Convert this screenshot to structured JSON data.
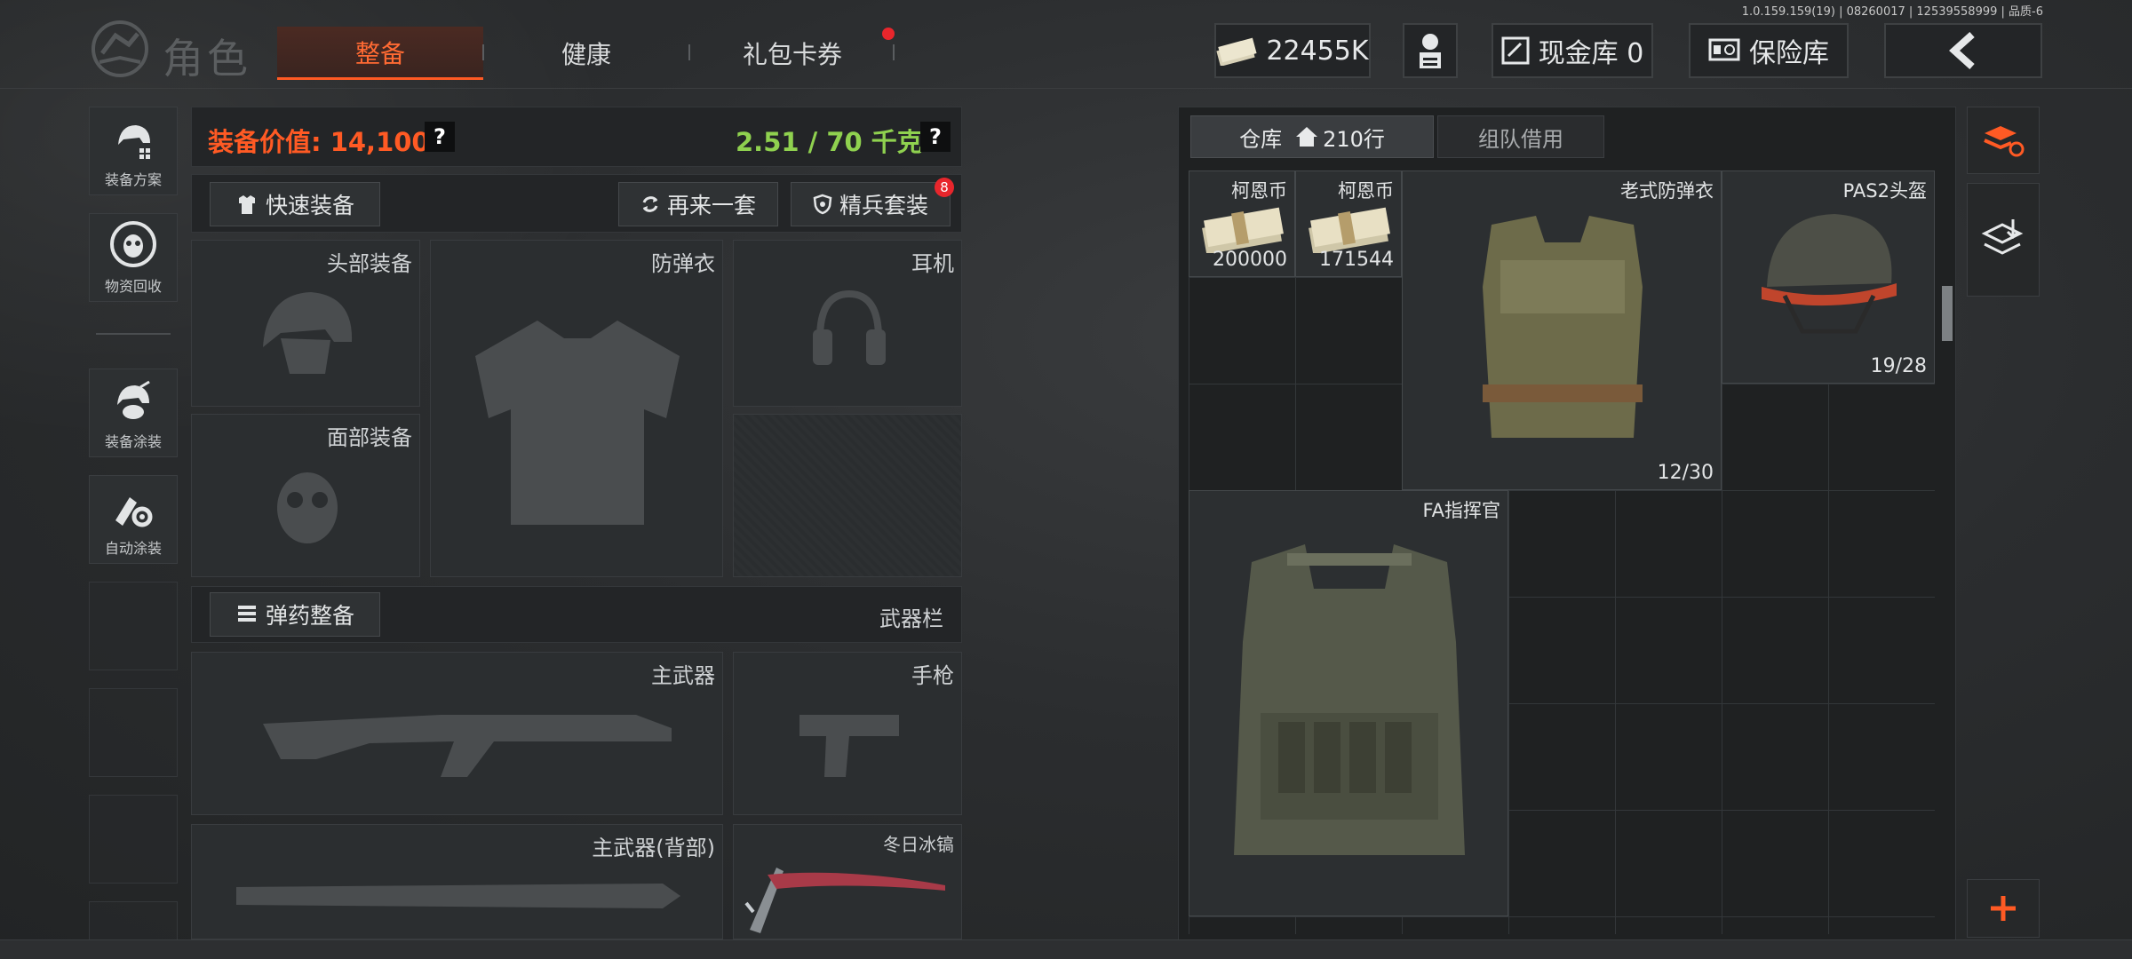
{
  "version_info": "1.0.159.159(19) | 08260017 | 12539558999 | 品质-6",
  "header": {
    "title": "角色",
    "tabs": [
      {
        "label": "整备",
        "active": true
      },
      {
        "label": "健康",
        "active": false
      },
      {
        "label": "礼包卡券",
        "active": false,
        "has_notification": true
      }
    ],
    "currency": "22455K",
    "cash_vault": "现金库 0",
    "insurance": "保险库"
  },
  "left_sidebar": {
    "items": [
      {
        "label": "装备方案",
        "icon": "helmet-grid-icon"
      },
      {
        "label": "物资回收",
        "icon": "recycle-mask-icon"
      },
      {
        "label": "装备涂装",
        "icon": "helmet-paint-icon"
      },
      {
        "label": "自动涂装",
        "icon": "brush-gear-icon"
      }
    ]
  },
  "equipment": {
    "value_label": "装备价值: 14,100",
    "weight_label": "2.51 / 70 千克",
    "help": "?",
    "quick_equip": "快速装备",
    "again_set": "再来一套",
    "elite_set": "精兵套装",
    "elite_badge": "8",
    "slots": {
      "head": "头部装备",
      "armor": "防弹衣",
      "headset": "耳机",
      "face": "面部装备"
    },
    "ammo_button": "弹药整备",
    "weapon_bar": "武器栏",
    "weapons": {
      "primary": "主武器",
      "pistol": "手枪",
      "primary_back": "主武器(背部)",
      "melee": "冬日冰镐"
    }
  },
  "warehouse": {
    "tab_storage": "仓库",
    "rows": "210行",
    "tab_team": "组队借用",
    "items": [
      {
        "name": "柯恩币",
        "count": "200000"
      },
      {
        "name": "柯恩币",
        "count": "171544"
      },
      {
        "name": "老式防弹衣",
        "count": "12/30"
      },
      {
        "name": "PAS2头盔",
        "count": "19/28"
      },
      {
        "name": "FA指挥官",
        "count": ""
      }
    ]
  },
  "colors": {
    "accent": "#ff5a24",
    "green": "#8fd14f",
    "badge": "#e8262c"
  }
}
